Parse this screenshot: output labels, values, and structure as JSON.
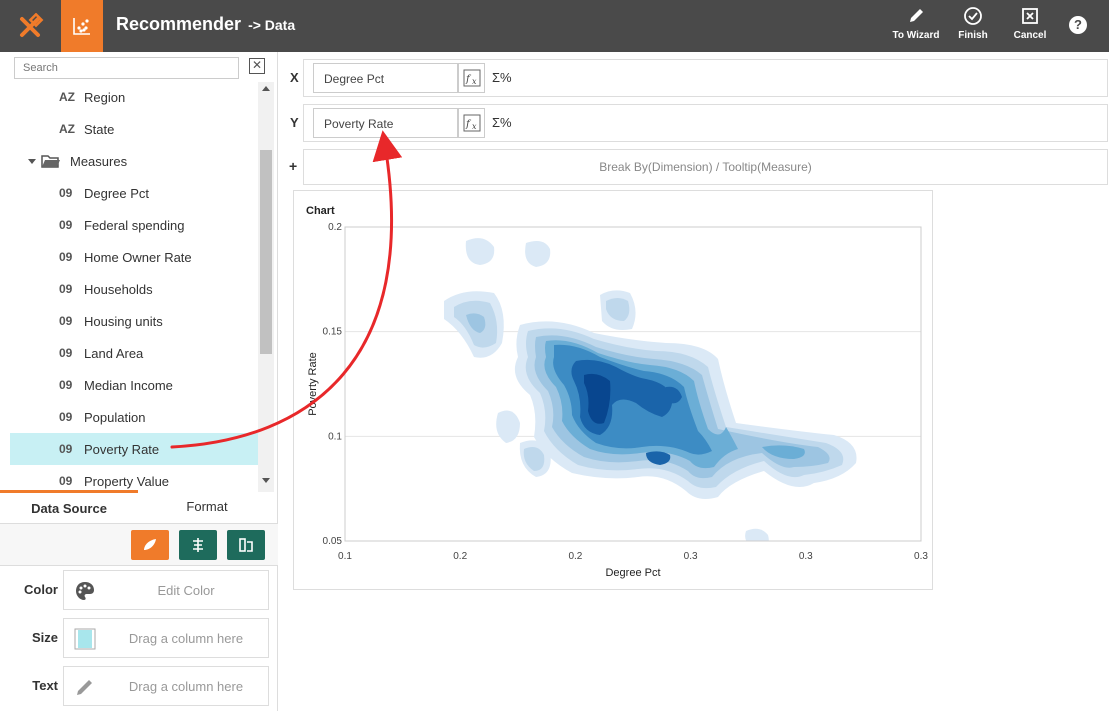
{
  "header": {
    "title": "Recommender",
    "subtitle": "-> Data",
    "buttons": {
      "wizard": "To Wizard",
      "finish": "Finish",
      "cancel": "Cancel"
    },
    "help": "?"
  },
  "sidebar": {
    "search_placeholder": "Search",
    "fields": [
      {
        "type": "AZ",
        "label": "Region"
      },
      {
        "type": "AZ",
        "label": "State"
      },
      {
        "type": "folder",
        "label": "Measures"
      },
      {
        "type": "09",
        "label": "Degree Pct"
      },
      {
        "type": "09",
        "label": "Federal spending"
      },
      {
        "type": "09",
        "label": "Home Owner Rate"
      },
      {
        "type": "09",
        "label": "Households"
      },
      {
        "type": "09",
        "label": "Housing units"
      },
      {
        "type": "09",
        "label": "Land Area"
      },
      {
        "type": "09",
        "label": "Median Income"
      },
      {
        "type": "09",
        "label": "Population"
      },
      {
        "type": "09",
        "label": "Poverty Rate",
        "selected": true
      },
      {
        "type": "09",
        "label": "Property Value"
      }
    ],
    "tabs": {
      "data_source": "Data Source",
      "format": "Format"
    },
    "props": {
      "color_label": "Color",
      "color_placeholder": "Edit Color",
      "size_label": "Size",
      "size_placeholder": "Drag a column here",
      "text_label": "Text",
      "text_placeholder": "Drag a column here"
    },
    "accent_color": "#f07b2a",
    "tool_color": "#1e6b5c"
  },
  "bindings": {
    "x_label": "X",
    "x_field": "Degree Pct",
    "y_label": "Y",
    "y_field": "Poverty Rate",
    "sigma": "Σ%",
    "fx": "f(x)",
    "break_plus": "+",
    "break_placeholder": "Break By(Dimension) / Tooltip(Measure)"
  },
  "chart_data": {
    "type": "heatmap",
    "title": "Chart",
    "xlabel": "Degree Pct",
    "ylabel": "Poverty Rate",
    "x_ticks": [
      "0.1",
      "0.2",
      "0.2",
      "0.3",
      "0.3",
      "0.3"
    ],
    "y_ticks": [
      "0.2",
      "0.15",
      "0.1",
      "0.05"
    ],
    "xlim": [
      0.1,
      0.35
    ],
    "ylim": [
      0.05,
      0.2
    ],
    "colors": [
      "#dbe9f6",
      "#bfd8ec",
      "#9dc5e2",
      "#6baed6",
      "#3d8cc4",
      "#1a64aa",
      "#08468f"
    ],
    "grid": true
  }
}
